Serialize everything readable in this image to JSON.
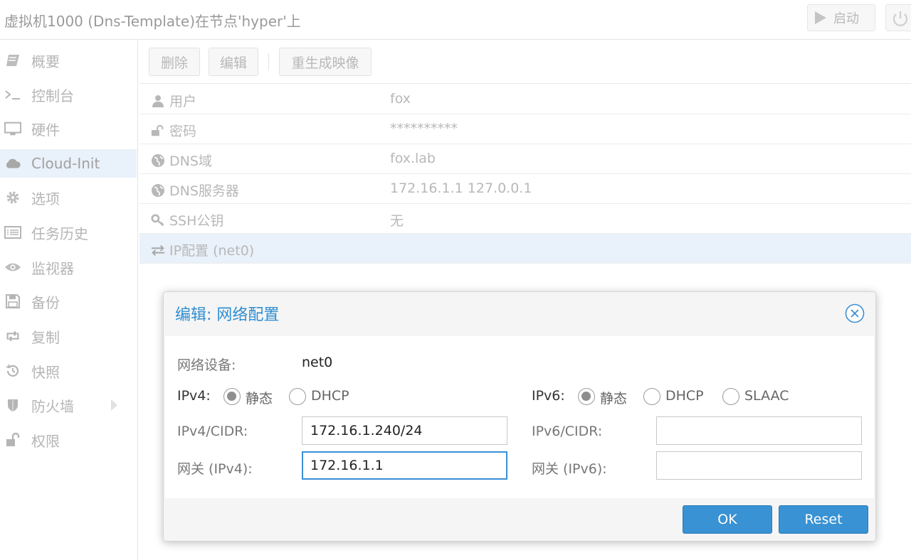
{
  "window": {
    "title": "虚拟机1000 (Dns-Template)在节点'hyper'上",
    "start_label": "启动"
  },
  "sidebar": {
    "items": [
      {
        "label": "概要",
        "icon": "book-icon"
      },
      {
        "label": "控制台",
        "icon": "terminal-icon"
      },
      {
        "label": "硬件",
        "icon": "monitor-icon"
      },
      {
        "label": "Cloud-Init",
        "icon": "cloud-icon",
        "active": true
      },
      {
        "label": "选项",
        "icon": "gear-icon"
      },
      {
        "label": "任务历史",
        "icon": "list-icon"
      },
      {
        "label": "监视器",
        "icon": "eye-icon"
      },
      {
        "label": "备份",
        "icon": "floppy-icon"
      },
      {
        "label": "复制",
        "icon": "retweet-icon"
      },
      {
        "label": "快照",
        "icon": "history-icon"
      },
      {
        "label": "防火墙",
        "icon": "shield-icon"
      },
      {
        "label": "权限",
        "icon": "unlock-icon"
      }
    ]
  },
  "toolbar": {
    "remove_label": "删除",
    "edit_label": "编辑",
    "regenerate_label": "重生成映像"
  },
  "grid": {
    "rows": [
      {
        "key": "用户",
        "value": "fox",
        "icon": "user-icon"
      },
      {
        "key": "密码",
        "value": "**********",
        "icon": "unlock-icon"
      },
      {
        "key": "DNS域",
        "value": "fox.lab",
        "icon": "globe-icon"
      },
      {
        "key": "DNS服务器",
        "value": "172.16.1.1 127.0.0.1",
        "icon": "globe-icon"
      },
      {
        "key": "SSH公钥",
        "value": "无",
        "icon": "key-icon"
      },
      {
        "key": "IP配置 (net0)",
        "value": "",
        "icon": "exchange-icon",
        "selected": true
      }
    ]
  },
  "dialog": {
    "title": "编辑: 网络配置",
    "device_label": "网络设备:",
    "device_value": "net0",
    "ipv4_label": "IPv4:",
    "ipv4_options": [
      "静态",
      "DHCP"
    ],
    "ipv4_selected": "静态",
    "ipv6_label": "IPv6:",
    "ipv6_options": [
      "静态",
      "DHCP",
      "SLAAC"
    ],
    "ipv6_selected": "静态",
    "ipv4_cidr_label": "IPv4/CIDR:",
    "ipv4_cidr_value": "172.16.1.240/24",
    "gw4_label": "网关 (IPv4):",
    "gw4_value": "172.16.1.1",
    "ipv6_cidr_label": "IPv6/CIDR:",
    "ipv6_cidr_value": "",
    "gw6_label": "网关 (IPv6):",
    "gw6_value": "",
    "ok_label": "OK",
    "reset_label": "Reset"
  },
  "colors": {
    "accent": "#3892d3",
    "selection": "#e9f1fa"
  }
}
